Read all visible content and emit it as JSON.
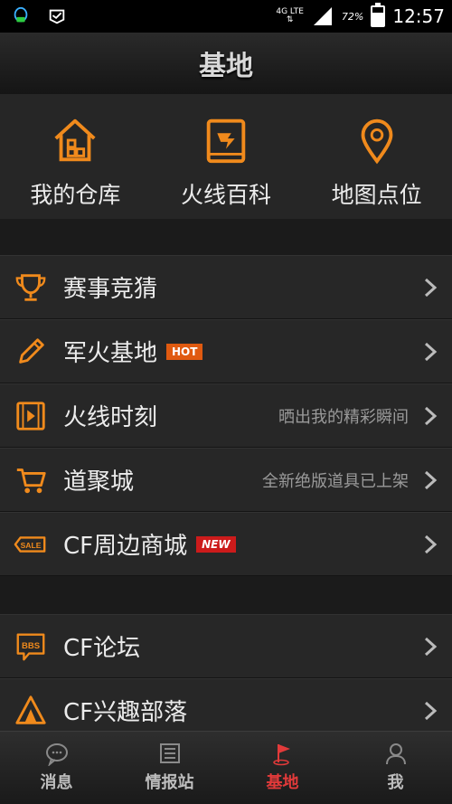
{
  "status_bar": {
    "network": "4G LTE",
    "battery": "72%",
    "battery_level": 0.72,
    "time": "12:57"
  },
  "header": {
    "title": "基地"
  },
  "quick_links": [
    {
      "label": "我的仓库",
      "icon": "warehouse-icon"
    },
    {
      "label": "火线百科",
      "icon": "encyclopedia-icon"
    },
    {
      "label": "地图点位",
      "icon": "map-pin-icon"
    }
  ],
  "menu_group_1": [
    {
      "label": "赛事竞猜",
      "icon": "trophy-icon",
      "badge": "",
      "subtitle": ""
    },
    {
      "label": "军火基地",
      "icon": "pencil-icon",
      "badge": "HOT",
      "subtitle": ""
    },
    {
      "label": "火线时刻",
      "icon": "video-icon",
      "badge": "",
      "subtitle": "晒出我的精彩瞬间"
    },
    {
      "label": "道聚城",
      "icon": "shopping-cart-icon",
      "badge": "",
      "subtitle": "全新绝版道具已上架"
    },
    {
      "label": "CF周边商城",
      "icon": "sale-tag-icon",
      "badge": "NEW",
      "subtitle": ""
    }
  ],
  "menu_group_2": [
    {
      "label": "CF论坛",
      "icon": "bbs-icon"
    },
    {
      "label": "CF兴趣部落",
      "icon": "tent-icon"
    }
  ],
  "tab_bar": [
    {
      "label": "消息",
      "icon": "chat-bubble-icon",
      "active": false
    },
    {
      "label": "情报站",
      "icon": "newspaper-icon",
      "active": false
    },
    {
      "label": "基地",
      "icon": "flag-icon",
      "active": true
    },
    {
      "label": "我",
      "icon": "person-icon",
      "active": false
    }
  ],
  "colors": {
    "accent": "#f08a1c",
    "active_tab": "#e23a3a",
    "hot": "#e05a10",
    "new": "#cc1b1b"
  }
}
